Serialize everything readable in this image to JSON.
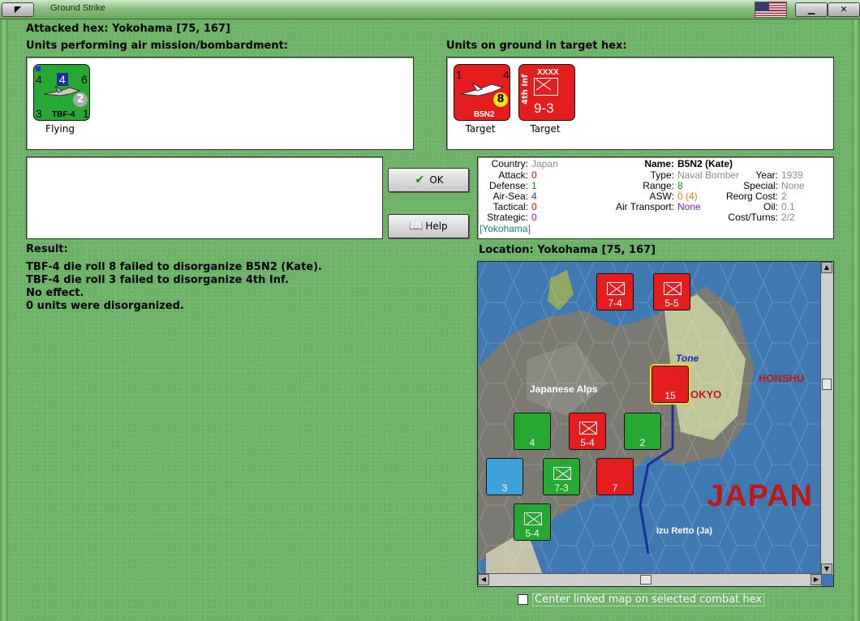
{
  "window": {
    "title": "Ground Strike"
  },
  "attacked_hex": "Attacked hex: Yokohama  [75, 167]",
  "air_units": {
    "heading": "Units performing air mission/bombardment:",
    "units": [
      {
        "name": "TBF-4",
        "top_left": "4",
        "top_mid": "4",
        "top_right": "6",
        "bottom_left": "3",
        "bottom_right": "1",
        "circle": "2",
        "status": "Flying"
      }
    ]
  },
  "ground_units": {
    "heading": "Units on ground in target hex:",
    "units": [
      {
        "name": "B5N2",
        "top_left": "1",
        "top_right": "4",
        "circle": "8",
        "status": "Target"
      },
      {
        "name": "4th Inf",
        "size": "XXXX",
        "strength": "9-3",
        "status": "Target"
      }
    ]
  },
  "buttons": {
    "ok": "OK",
    "help": "Help"
  },
  "info": {
    "country_label": "Country:",
    "country": "Japan",
    "attack_label": "Attack:",
    "attack": "0",
    "defense_label": "Defense:",
    "defense": "1",
    "airsea_label": "Air-Sea:",
    "airsea": "4",
    "tactical_label": "Tactical:",
    "tactical": "0",
    "strategic_label": "Strategic:",
    "strategic": "0",
    "location_link": "[Yokohama]",
    "name_label": "Name:",
    "name": "B5N2 (Kate)",
    "type_label": "Type:",
    "type": "Naval Bomber",
    "year_label": "Year:",
    "year": "1939",
    "range_label": "Range:",
    "range": "8",
    "special_label": "Special:",
    "special": "None",
    "asw_label": "ASW:",
    "asw": "0 (4)",
    "reorg_label": "Reorg Cost:",
    "reorg": "2",
    "airtransport_label": "Air Transport:",
    "airtransport": "None",
    "oil_label": "Oil:",
    "oil": "0.1",
    "costturns_label": "Cost/Turns:",
    "costturns": "2/2"
  },
  "result": {
    "heading": "Result:",
    "lines": [
      "TBF-4 die roll 8 failed to disorganize B5N2 (Kate).",
      "TBF-4 die roll 3 failed to disorganize 4th Inf.",
      "No effect.",
      "0 units were disorganized."
    ]
  },
  "location": {
    "heading": "Location:  Yokohama  [75, 167]"
  },
  "map": {
    "labels": {
      "honshu": "HONSHU",
      "japan": "JAPAN",
      "alps": "Japanese Alps",
      "tone": "Tone",
      "tokyo": "OKYO",
      "izu": "Izu Retto (Ja)"
    },
    "counters": [
      {
        "color": "red",
        "value": "7-4"
      },
      {
        "color": "red",
        "value": "5-5"
      },
      {
        "color": "red",
        "value": "15"
      },
      {
        "color": "red",
        "value": "5-4"
      },
      {
        "color": "green",
        "value": "4"
      },
      {
        "color": "green",
        "value": "2"
      },
      {
        "color": "green",
        "value": "7-3"
      },
      {
        "color": "red",
        "value": "7"
      },
      {
        "color": "blue",
        "value": "3"
      },
      {
        "color": "green",
        "value": "5-4"
      }
    ]
  },
  "checkbox": {
    "label": "Center linked map on selected combat hex",
    "checked": false
  },
  "colors": {
    "background": "#6fb36a",
    "counter_green": "#27a832",
    "counter_red": "#e41e1e",
    "zero_red": "#e00000",
    "green_val": "#128a12",
    "blue_val": "#1a3fd8",
    "magenta_val": "#c000c0",
    "grey_val": "#8a8a8a",
    "orange_val": "#e08000",
    "purple_val": "#8a1ab0",
    "teal_val": "#0a8a6a"
  }
}
